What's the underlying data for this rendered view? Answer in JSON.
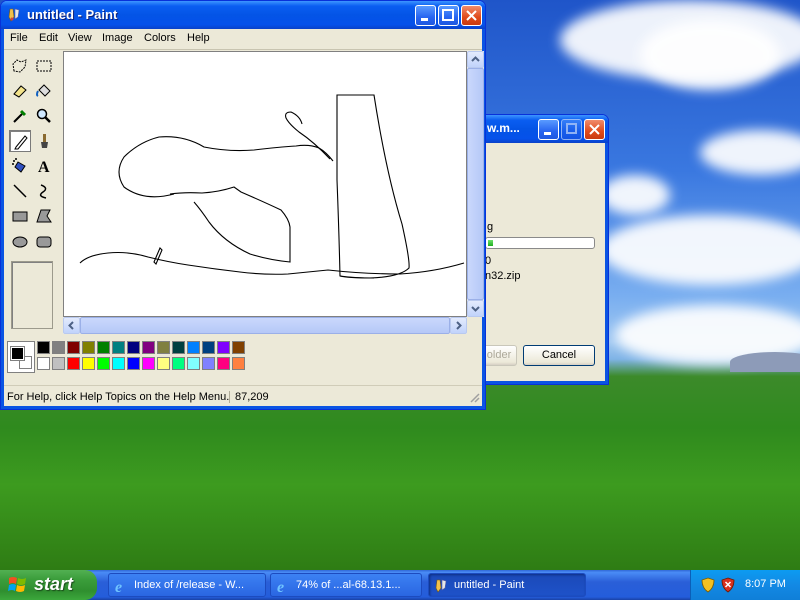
{
  "paint": {
    "title": "untitled - Paint",
    "menu": [
      "File",
      "Edit",
      "View",
      "Image",
      "Colors",
      "Help"
    ],
    "tools": [
      "free-form-select",
      "select",
      "eraser",
      "fill-with-color",
      "pick-color",
      "magnifier",
      "pencil",
      "brush",
      "airbrush",
      "text",
      "line",
      "curve",
      "rectangle",
      "polygon",
      "ellipse",
      "rounded-rectangle"
    ],
    "active_tool": "pencil",
    "palette_top": [
      "#000000",
      "#808080",
      "#800000",
      "#808000",
      "#008000",
      "#008080",
      "#000080",
      "#800080",
      "#808040",
      "#004040",
      "#0080ff",
      "#004080",
      "#8000ff",
      "#804000"
    ],
    "palette_bottom": [
      "#ffffff",
      "#c0c0c0",
      "#ff0000",
      "#ffff00",
      "#00ff00",
      "#00ffff",
      "#0000ff",
      "#ff00ff",
      "#ffff80",
      "#00ff80",
      "#80ffff",
      "#8080ff",
      "#ff0080",
      "#ff8040"
    ],
    "foreground_color": "#000000",
    "background_color": "#ffffff",
    "status_text": "For Help, click Help Topics on the Help Menu.",
    "coordinates": "87,209"
  },
  "download_dialog": {
    "title": "w.m...",
    "line1": "g",
    "progress": 0.05,
    "line2": "0",
    "line3": "n32.zip",
    "open_folder_label": "older",
    "cancel_label": "Cancel"
  },
  "taskbar": {
    "start_label": "start",
    "tasks": [
      {
        "label": "Index of /release - W...",
        "icon": "ie-icon"
      },
      {
        "label": "74% of ...al-68.13.1...",
        "icon": "ie-icon"
      },
      {
        "label": "untitled - Paint",
        "icon": "paint-icon"
      }
    ],
    "clock": "8:07 PM"
  }
}
